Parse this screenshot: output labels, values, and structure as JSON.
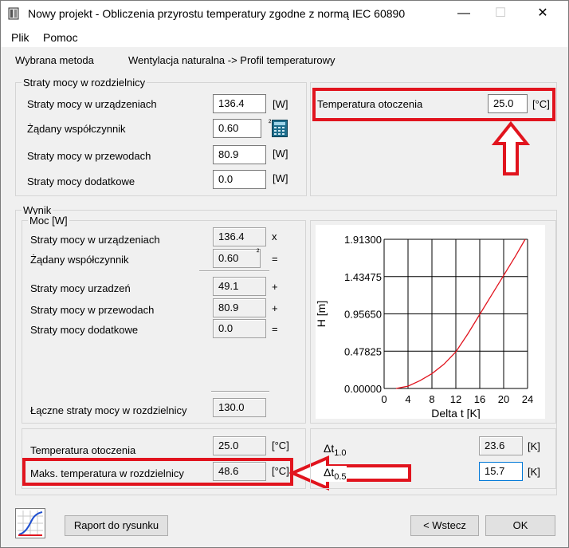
{
  "window": {
    "title": "Nowy projekt - Obliczenia przyrostu temperatury zgodne z normą IEC 60890",
    "minimize_glyph": "—",
    "maximize_glyph": "☐",
    "close_glyph": "✕"
  },
  "menu": {
    "items": [
      "Plik",
      "Pomoc"
    ]
  },
  "method": {
    "label": "Wybrana metoda",
    "value": "Wentylacja naturalna -> Profil temperaturowy"
  },
  "losses_group": {
    "title": "Straty mocy w rozdzielnicy",
    "rows": [
      {
        "label": "Straty mocy w urządzeniach",
        "value": "136.4",
        "unit": "[W]"
      },
      {
        "label": "Żądany współczynnik",
        "value": "0.60",
        "unit": "²"
      },
      {
        "label": "Straty mocy w przewodach",
        "value": "80.9",
        "unit": "[W]"
      },
      {
        "label": "Straty mocy dodatkowe",
        "value": "0.0",
        "unit": "[W]"
      }
    ]
  },
  "ambient_top": {
    "label": "Temperatura otoczenia",
    "value": "25.0",
    "unit": "[°C]"
  },
  "result": {
    "title": "Wynik",
    "power_group_title": "Moc [W]",
    "rows": [
      {
        "label": "Straty mocy w urządzeniach",
        "value": "136.4",
        "op": "x"
      },
      {
        "label": "Żądany współczynnik",
        "value": "0.60",
        "sup": "²",
        "op": "="
      },
      {
        "label": "Straty mocy urzadzeń",
        "value": "49.1",
        "op": "+"
      },
      {
        "label": "Straty mocy w przewodach",
        "value": "80.9",
        "op": "+"
      },
      {
        "label": "Straty mocy dodatkowe",
        "value": "0.0",
        "op": "="
      }
    ],
    "total": {
      "label": "Łączne straty mocy w rozdzielnicy",
      "value": "130.0"
    }
  },
  "temps": {
    "ambient": {
      "label": "Temperatura otoczenia",
      "value": "25.0",
      "unit": "[°C]"
    },
    "max": {
      "label": "Maks. temperatura w rozdzielnicy",
      "value": "48.6",
      "unit": "[°C]"
    },
    "dt10": {
      "label": "Δt",
      "sub": "1.0",
      "value": "23.6",
      "unit": "[K]"
    },
    "dt05": {
      "label": "Δt",
      "sub": "0.5",
      "value": "15.7",
      "unit": "[K]"
    }
  },
  "buttons": {
    "report": "Raport do rysunku",
    "back": "< Wstecz",
    "ok": "OK"
  },
  "colors": {
    "highlight": "#e1141e",
    "curve": "#e1141e",
    "accent": "#0078d7"
  },
  "chart_data": {
    "type": "line",
    "xlabel": "Delta t [K]",
    "ylabel": "H [m]",
    "xlim": [
      0,
      24
    ],
    "ylim": [
      0,
      1.913
    ],
    "xticks": [
      "0",
      "4",
      "8",
      "12",
      "16",
      "20",
      "24"
    ],
    "yticks": [
      "0.00000",
      "0.47825",
      "0.95650",
      "1.43475",
      "1.91300"
    ],
    "grid": true,
    "series": [
      {
        "x": [
          2,
          4,
          6,
          8,
          10,
          12,
          14,
          16,
          18,
          20,
          22,
          23.6
        ],
        "y": [
          0.0,
          0.03,
          0.1,
          0.19,
          0.31,
          0.47,
          0.7,
          0.95,
          1.2,
          1.45,
          1.7,
          1.913
        ]
      }
    ]
  }
}
